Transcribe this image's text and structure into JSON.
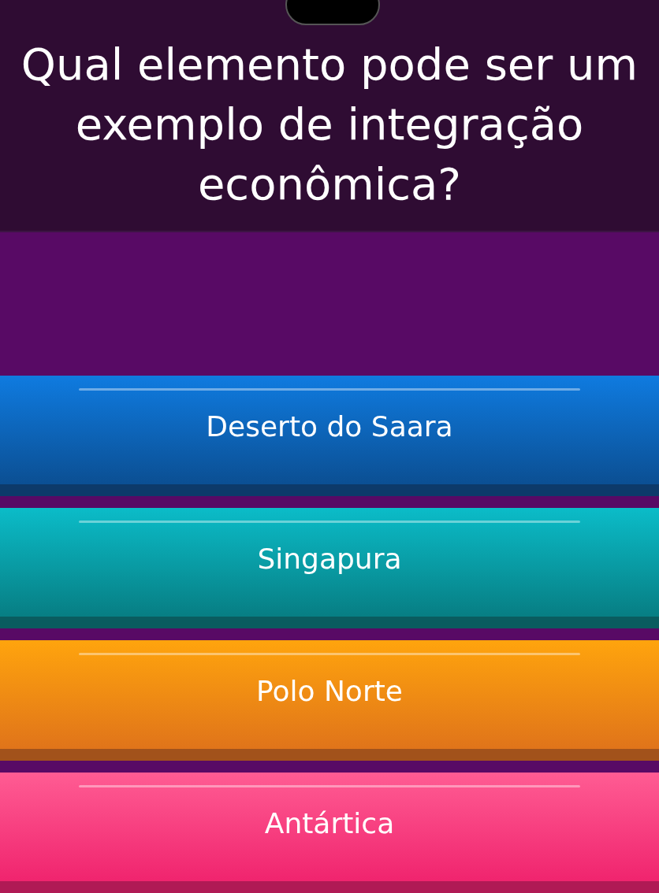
{
  "question": {
    "text": "Qual elemento pode ser um exemplo de integração econômica?"
  },
  "answers": [
    {
      "label": "Deserto do Saara",
      "color": "#0f7be0"
    },
    {
      "label": "Singapura",
      "color": "#0bbcc8"
    },
    {
      "label": "Polo Norte",
      "color": "#ffa40d"
    },
    {
      "label": "Antártica",
      "color": "#ff5c93"
    }
  ]
}
